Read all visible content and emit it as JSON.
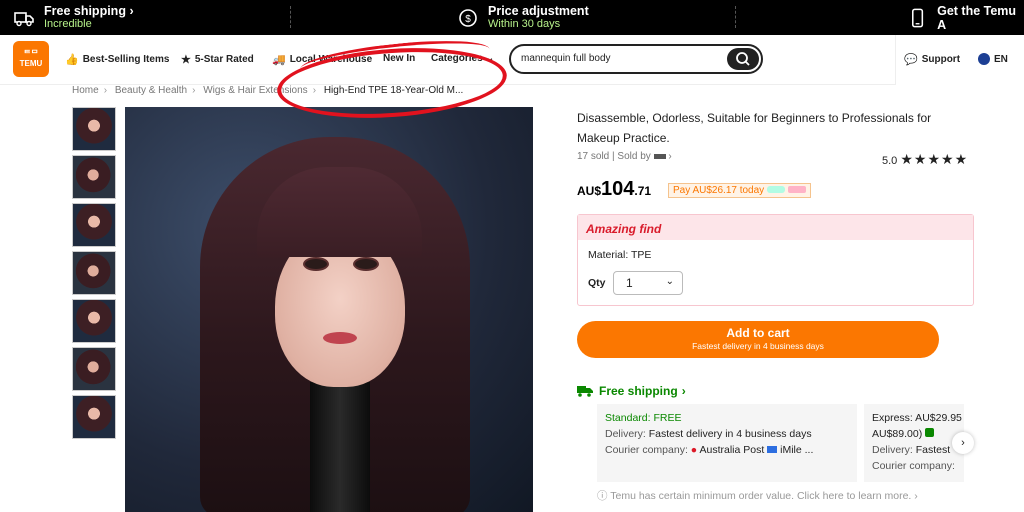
{
  "promo_bar": {
    "free_shipping_title": "Free shipping",
    "free_shipping_sub": "Incredible",
    "price_adjust_title": "Price adjustment",
    "price_adjust_sub": "Within 30 days",
    "app_title": "Get the Temu A"
  },
  "logo": {
    "line1": "ᄐᄆ",
    "line2": "TEMU"
  },
  "nav": {
    "items": [
      "Best-Selling Items",
      "5-Star Rated",
      "Local Warehouse",
      "New In",
      "Categories"
    ],
    "search_value": "mannequin full body",
    "support": "Support",
    "language": "EN"
  },
  "breadcrumb": [
    "Home",
    "Beauty & Health",
    "Wigs & Hair Extensions",
    "High-End TPE 18-Year-Old M..."
  ],
  "product": {
    "title": "Disassemble, Odorless, Suitable for Beginners to Professionals for Makeup Practice.",
    "sold": "17 sold",
    "sold_by": "Sold by",
    "rating": "5.0",
    "stars": "★★★★★",
    "price_currency": "AU$",
    "price_whole": "104",
    "price_cents": ".71",
    "pay_later": "Pay AU$26.17 today",
    "badge_title": "Amazing find",
    "material": "Material: TPE",
    "qty_label": "Qty",
    "qty_value": "1",
    "add_to_cart": "Add to cart",
    "add_to_cart_sub": "Fastest delivery in 4 business days"
  },
  "shipping": {
    "title": "Free shipping",
    "standard_label": "Standard: FREE",
    "standard_delivery_label": "Delivery:",
    "standard_delivery": "Fastest delivery in 4 business days",
    "standard_courier_label": "Courier company:",
    "standard_courier": "Australia Post",
    "standard_courier2": "iMile ...",
    "express_label": "Express: AU$29.95",
    "express_sub": "AU$89.00)",
    "express_delivery_label": "Delivery:",
    "express_delivery": "Fastest",
    "express_courier_label": "Courier company:",
    "note": "Temu has certain minimum order value. Click here to learn more."
  },
  "colors": {
    "brand": "#fb7701",
    "success": "#0a8800",
    "alert": "#d91b2b",
    "annotation": "#e1121e"
  }
}
